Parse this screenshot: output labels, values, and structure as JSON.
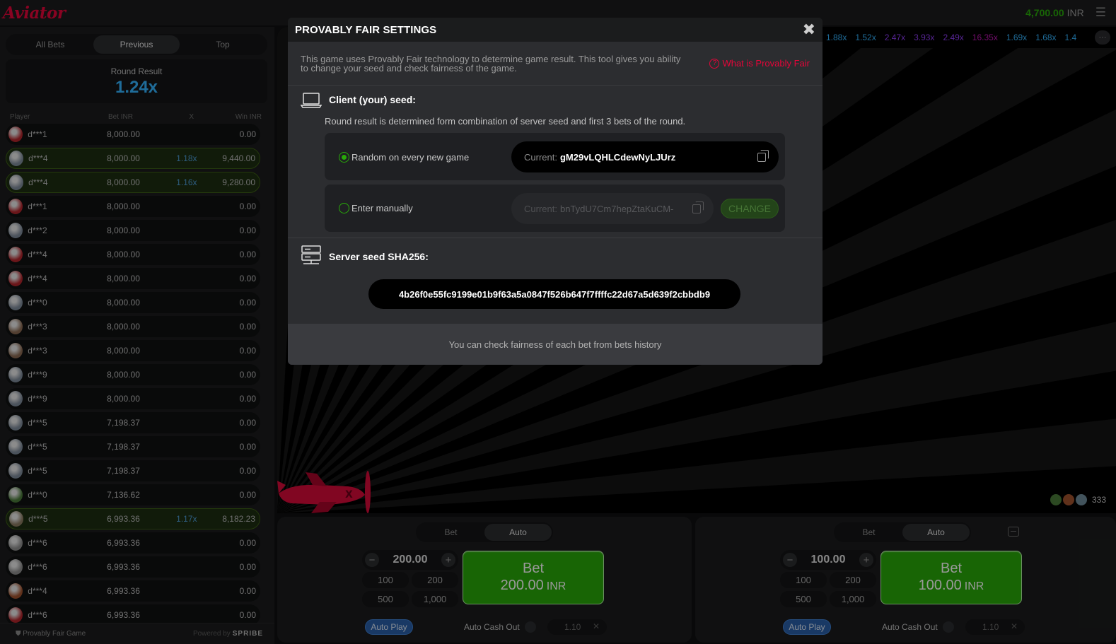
{
  "app": {
    "logo": "Aviator",
    "balance": "4,700.00",
    "currency": "INR"
  },
  "bets_panel": {
    "tabs": [
      "All Bets",
      "Previous",
      "Top"
    ],
    "active_tab": "Previous",
    "round_result_label": "Round Result",
    "round_result_value": "1.24x",
    "columns": {
      "player": "Player",
      "bet": "Bet INR",
      "x": "X",
      "win": "Win INR"
    },
    "rows": [
      {
        "name": "d***1",
        "bet": "8,000.00",
        "x": "",
        "win": "0.00",
        "won": false,
        "avatar": "#b3262c"
      },
      {
        "name": "d***4",
        "bet": "8,000.00",
        "x": "1.18x",
        "win": "9,440.00",
        "won": true,
        "avatar": "#7e8a99"
      },
      {
        "name": "d***4",
        "bet": "8,000.00",
        "x": "1.16x",
        "win": "9,280.00",
        "won": true,
        "avatar": "#7e8a99"
      },
      {
        "name": "d***1",
        "bet": "8,000.00",
        "x": "",
        "win": "0.00",
        "won": false,
        "avatar": "#b3262c"
      },
      {
        "name": "d***2",
        "bet": "8,000.00",
        "x": "",
        "win": "0.00",
        "won": false,
        "avatar": "#7e8a99"
      },
      {
        "name": "d***4",
        "bet": "8,000.00",
        "x": "",
        "win": "0.00",
        "won": false,
        "avatar": "#b3262c"
      },
      {
        "name": "d***4",
        "bet": "8,000.00",
        "x": "",
        "win": "0.00",
        "won": false,
        "avatar": "#b3262c"
      },
      {
        "name": "d***0",
        "bet": "8,000.00",
        "x": "",
        "win": "0.00",
        "won": false,
        "avatar": "#7e8a99"
      },
      {
        "name": "d***3",
        "bet": "8,000.00",
        "x": "",
        "win": "0.00",
        "won": false,
        "avatar": "#8a6a52"
      },
      {
        "name": "d***3",
        "bet": "8,000.00",
        "x": "",
        "win": "0.00",
        "won": false,
        "avatar": "#8a6a52"
      },
      {
        "name": "d***9",
        "bet": "8,000.00",
        "x": "",
        "win": "0.00",
        "won": false,
        "avatar": "#7e8a99"
      },
      {
        "name": "d***9",
        "bet": "8,000.00",
        "x": "",
        "win": "0.00",
        "won": false,
        "avatar": "#7e8a99"
      },
      {
        "name": "d***5",
        "bet": "7,198.37",
        "x": "",
        "win": "0.00",
        "won": false,
        "avatar": "#7e8a99"
      },
      {
        "name": "d***5",
        "bet": "7,198.37",
        "x": "",
        "win": "0.00",
        "won": false,
        "avatar": "#7e8a99"
      },
      {
        "name": "d***5",
        "bet": "7,198.37",
        "x": "",
        "win": "0.00",
        "won": false,
        "avatar": "#7e8a99"
      },
      {
        "name": "d***0",
        "bet": "7,136.62",
        "x": "",
        "win": "0.00",
        "won": false,
        "avatar": "#4a7a3a"
      },
      {
        "name": "d***5",
        "bet": "6,993.36",
        "x": "1.17x",
        "win": "8,182.23",
        "won": true,
        "avatar": "#8a7a62"
      },
      {
        "name": "d***6",
        "bet": "6,993.36",
        "x": "",
        "win": "0.00",
        "won": false,
        "avatar": "#8e8e8e"
      },
      {
        "name": "d***6",
        "bet": "6,993.36",
        "x": "",
        "win": "0.00",
        "won": false,
        "avatar": "#8e8e8e"
      },
      {
        "name": "d***4",
        "bet": "6,993.36",
        "x": "",
        "win": "0.00",
        "won": false,
        "avatar": "#a0522d"
      },
      {
        "name": "d***6",
        "bet": "6,993.36",
        "x": "",
        "win": "0.00",
        "won": false,
        "avatar": "#b3262c"
      }
    ],
    "footer_left": "Provably Fair Game",
    "footer_powered": "Powered by",
    "footer_brand": "SPRIBE"
  },
  "history": [
    {
      "v": "1.88x",
      "c": "#34b4ff"
    },
    {
      "v": "1.52x",
      "c": "#34b4ff"
    },
    {
      "v": "2.47x",
      "c": "#913ef8"
    },
    {
      "v": "3.93x",
      "c": "#913ef8"
    },
    {
      "v": "2.49x",
      "c": "#913ef8"
    },
    {
      "v": "16.35x",
      "c": "#c017b4"
    },
    {
      "v": "1.69x",
      "c": "#34b4ff"
    },
    {
      "v": "1.68x",
      "c": "#34b4ff"
    },
    {
      "v": "1.4",
      "c": "#34b4ff"
    }
  ],
  "history_more": "···",
  "players_online": "333",
  "bet_panels": [
    {
      "tabs": [
        "Bet",
        "Auto"
      ],
      "active": "Auto",
      "amount": "200.00",
      "quick": [
        "100",
        "200",
        "500",
        "1,000"
      ],
      "bet_label": "Bet",
      "bet_amount": "200.00",
      "bet_currency": "INR",
      "autoplay": "Auto Play",
      "auto_cashout": "Auto Cash Out",
      "cashout_value": "1.10"
    },
    {
      "tabs": [
        "Bet",
        "Auto"
      ],
      "active": "Auto",
      "amount": "100.00",
      "quick": [
        "100",
        "200",
        "500",
        "1,000"
      ],
      "bet_label": "Bet",
      "bet_amount": "100.00",
      "bet_currency": "INR",
      "autoplay": "Auto Play",
      "auto_cashout": "Auto Cash Out",
      "cashout_value": "1.10"
    }
  ],
  "modal": {
    "title": "PROVABLY FAIR SETTINGS",
    "intro": "This game uses Provably Fair technology to determine game result. This tool gives you ability to change your seed and check fairness of the game.",
    "what_link": "What is Provably Fair",
    "client_title": "Client (your) seed:",
    "client_desc": "Round result is determined form combination of server seed and first 3 bets of the round.",
    "opt_random": "Random on every new game",
    "opt_manual": "Enter manually",
    "current_label": "Current:",
    "random_seed": "gM29vLQHLCdewNyLJUrz",
    "manual_seed": "bnTydU7Cm7hepZtaKuCM-",
    "change_label": "CHANGE",
    "server_title": "Server seed SHA256:",
    "server_hash": "4b26f0e55fc9199e01b9f63a5a0847f526b647f7ffffc22d67a5d639f2cbbdb9",
    "footer": "You can check fairness of each bet from bets history"
  }
}
